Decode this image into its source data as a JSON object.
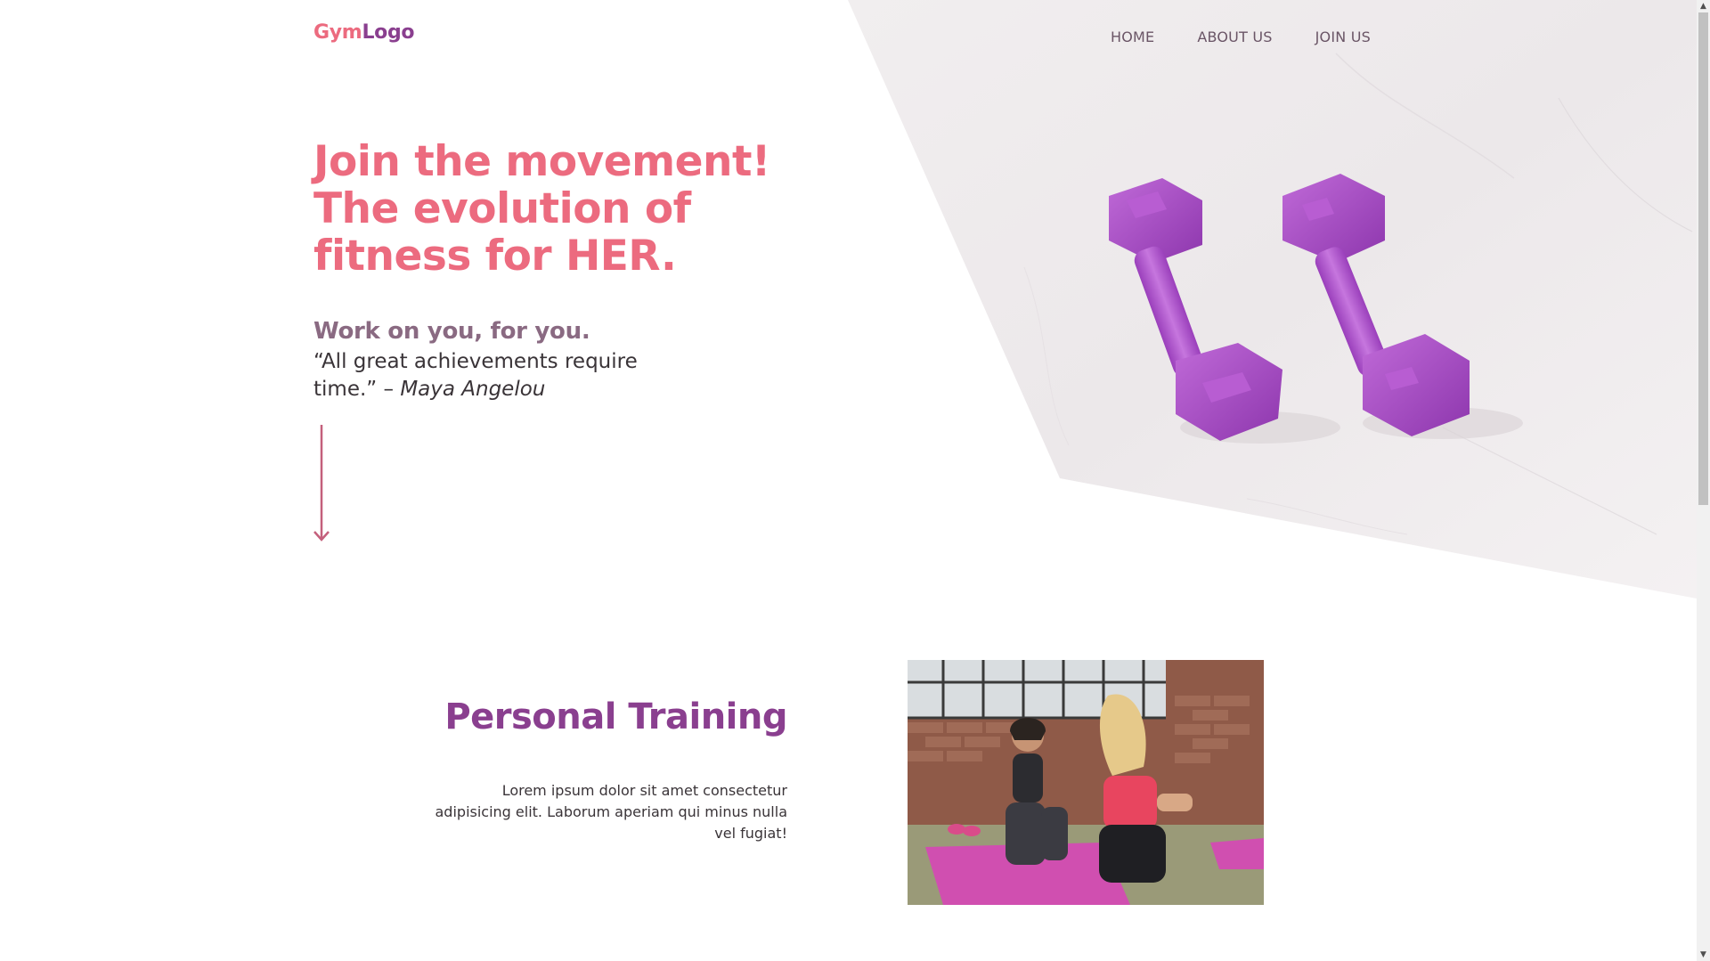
{
  "logo": {
    "part1": "Gym",
    "part2": "Logo"
  },
  "nav": {
    "items": [
      {
        "label": "HOME"
      },
      {
        "label": "ABOUT US"
      },
      {
        "label": "JOIN US"
      }
    ]
  },
  "hero": {
    "title_line1": "Join the movement!",
    "title_line2": "The evolution of",
    "title_line3": "fitness for HER.",
    "subtitle": "Work on you, for you.",
    "quote": "“All great achievements require time.” – ",
    "quote_author": "Maya Angelou",
    "scroll_icon": "arrow-down-icon"
  },
  "section": {
    "title": "Personal Training",
    "text": "Lorem ipsum dolor sit amet consectetur adipisicing elit. Laborum aperiam qui minus nulla vel fugiat!"
  },
  "colors": {
    "primary_pink": "#ec6b7f",
    "primary_purple": "#8a3f8f",
    "muted_mauve": "#8a6a82",
    "text_dark": "#3a3438",
    "dumbbell_purple": "#a54bc4"
  }
}
